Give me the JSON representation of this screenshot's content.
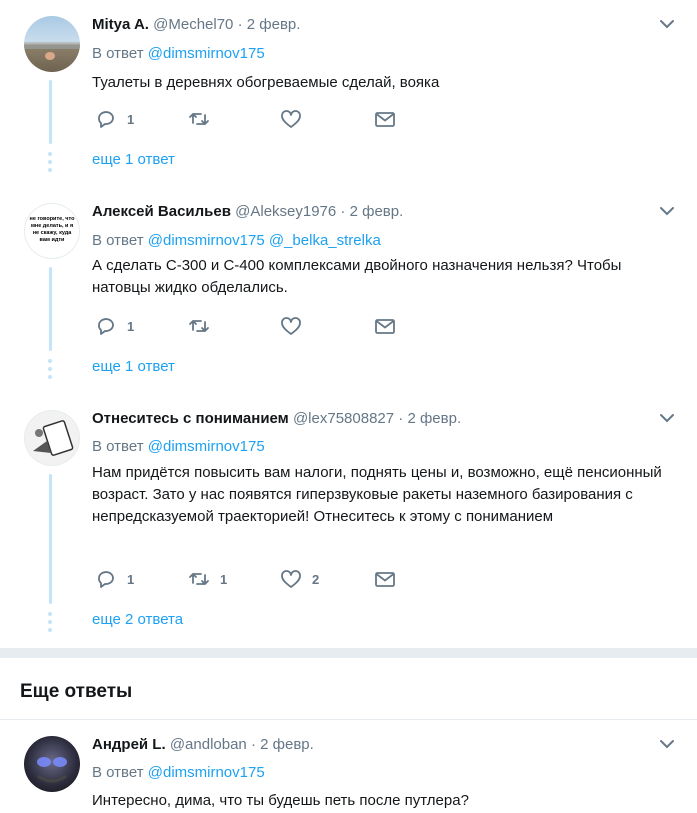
{
  "tweets": [
    {
      "name": "Mitya A.",
      "handle": "@Mechel70",
      "separator": "·",
      "date": "2 февр.",
      "reply_prefix": "В ответ",
      "reply_to": [
        "@dimsmirnov175"
      ],
      "text": "Туалеты в деревнях обогреваемые сделай, вояка",
      "reply_count": "1",
      "retweet_count": "",
      "like_count": "",
      "more_replies": "еще 1 ответ"
    },
    {
      "name": "Алексей Васильев",
      "handle": "@Aleksey1976",
      "separator": "·",
      "date": "2 февр.",
      "reply_prefix": "В ответ",
      "reply_to": [
        "@dimsmirnov175",
        "@_belka_strelka"
      ],
      "text": "А сделать С-300 и С-400 комплексами двойного назначения нельзя? Чтобы натовцы жидко обделались.",
      "reply_count": "1",
      "retweet_count": "",
      "like_count": "",
      "more_replies": "еще 1 ответ",
      "avatar_text": "не говорите, что мне делать, и я не скажу, куда вам идти"
    },
    {
      "name": "Отнеситесь с пониманием",
      "handle": "@lex75808827",
      "separator": "·",
      "date": "2 февр.",
      "reply_prefix": "В ответ",
      "reply_to": [
        "@dimsmirnov175"
      ],
      "text": "Нам придётся повысить вам налоги, поднять цены и, возможно, ещё пенсионный возраст. Зато у нас появятся гиперзвуковые ракеты наземного базирования с непредсказуемой траекторией! Отнеситесь к этому с пониманием",
      "reply_count": "1",
      "retweet_count": "1",
      "like_count": "2",
      "more_replies": "еще 2 ответа"
    },
    {
      "name": "Андрей L.",
      "handle": "@andloban",
      "separator": "·",
      "date": "2 февр.",
      "reply_prefix": "В ответ",
      "reply_to": [
        "@dimsmirnov175"
      ],
      "text": "Интересно, дима, что ты будешь петь после путлера?"
    }
  ],
  "section": {
    "title": "Еще ответы"
  },
  "colors": {
    "link": "#1da1f2",
    "muted": "#657786",
    "text": "#14171a",
    "border": "#e6ecf0",
    "thread": "#c4e4fa"
  },
  "icons": [
    "reply-icon",
    "retweet-icon",
    "like-icon",
    "direct-message-icon",
    "chevron-down-icon"
  ]
}
